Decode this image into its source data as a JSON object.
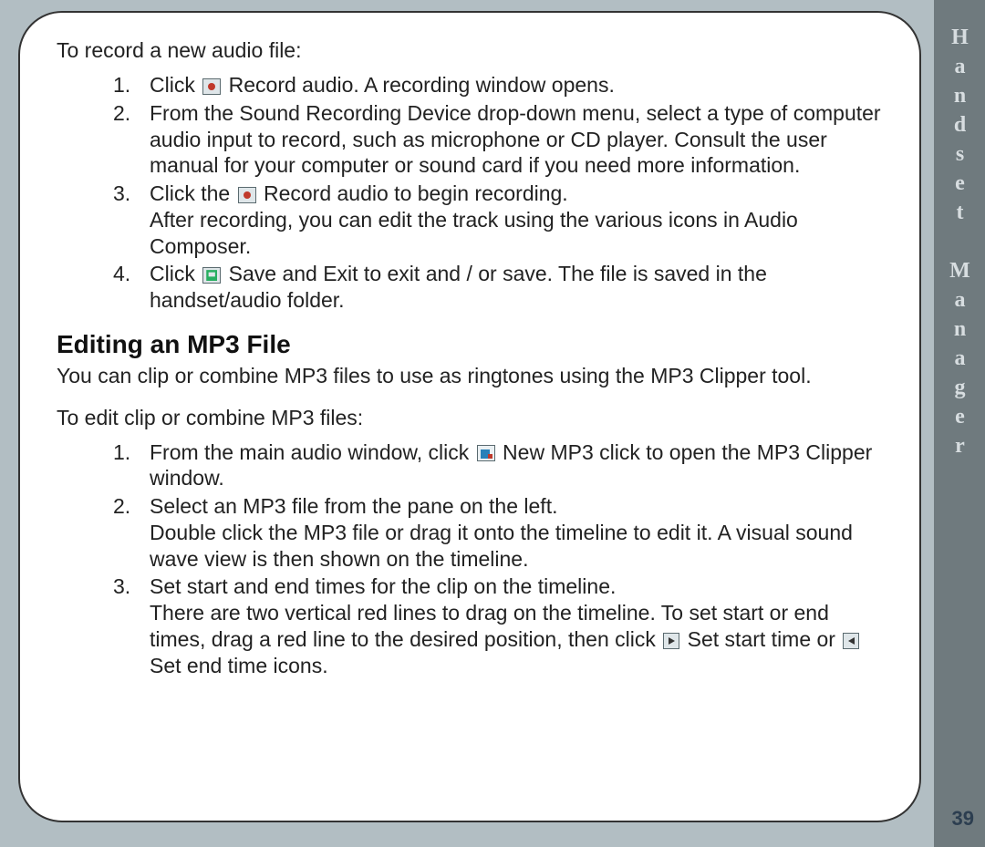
{
  "sidebar": {
    "title": "Handset Manager"
  },
  "page_number": "39",
  "section1": {
    "intro": "To record a new audio file:",
    "steps": {
      "s1a": "Click ",
      "s1b": " Record audio. A recording window opens.",
      "s2": "From the Sound Recording Device drop-down menu, select a type of computer audio input to record, such as microphone or CD player. Consult the user manual for your computer or sound card if you need more information.",
      "s3a": "Click the ",
      "s3b": " Record audio to begin recording.",
      "s3c": "After recording, you can edit the track using the various icons in Audio Composer.",
      "s4a": "Click ",
      "s4b": " Save and Exit to exit and / or save. The file is saved in the handset/audio folder."
    }
  },
  "section2": {
    "heading": "Editing an MP3 File",
    "desc": "You can clip or combine MP3 files to use as ringtones using the MP3 Clipper tool.",
    "intro": "To edit clip or combine MP3 files:",
    "steps": {
      "s1a": "From the main audio window, click ",
      "s1b": " New MP3 click to open the MP3 Clipper window.",
      "s2a": "Select an MP3 file from the pane on the left.",
      "s2b": "Double click the MP3 file or drag it onto the timeline to edit it. A visual sound wave view is then shown on the timeline.",
      "s3a": "Set start and end times for the clip on the timeline.",
      "s3b": "There are two vertical red lines to drag on the timeline. To set start or end times, drag a red line to the desired position, then click ",
      "s3c": "  Set start time or ",
      "s3d": " Set end time icons."
    }
  }
}
